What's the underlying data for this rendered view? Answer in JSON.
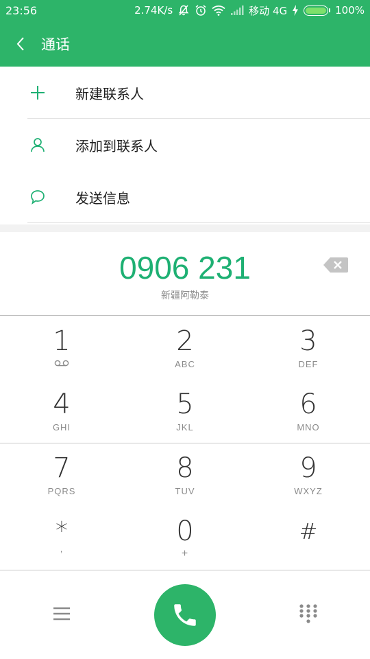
{
  "status_bar": {
    "time": "23:56",
    "speed": "2.74K/s",
    "carrier": "移动 4G",
    "battery": "100%",
    "battery_level": 1.0,
    "icons": [
      "mute-notification-icon",
      "alarm-icon",
      "wifi-icon",
      "signal-icon",
      "charging-icon",
      "battery-icon"
    ]
  },
  "app_bar": {
    "title": "通话",
    "background": "#2db469",
    "back_icon": "chevron-left-icon"
  },
  "menu": {
    "items": [
      {
        "label": "新建联系人",
        "icon": "plus-icon"
      },
      {
        "label": "添加到联系人",
        "icon": "person-icon"
      },
      {
        "label": "发送信息",
        "icon": "message-bubble-icon"
      }
    ]
  },
  "dial_display": {
    "number": "0906 231",
    "location": "新疆阿勒泰",
    "number_color": "#1eb073"
  },
  "keypad": {
    "keys": [
      {
        "digit": "1",
        "letters": ""
      },
      {
        "digit": "2",
        "letters": "ABC"
      },
      {
        "digit": "3",
        "letters": "DEF"
      },
      {
        "digit": "4",
        "letters": "GHI"
      },
      {
        "digit": "5",
        "letters": "JKL"
      },
      {
        "digit": "6",
        "letters": "MNO"
      },
      {
        "digit": "7",
        "letters": "PQRS"
      },
      {
        "digit": "8",
        "letters": "TUV"
      },
      {
        "digit": "9",
        "letters": "WXYZ"
      },
      {
        "digit": "*",
        "letters": ","
      },
      {
        "digit": "0",
        "letters": "+"
      },
      {
        "digit": "#",
        "letters": ""
      }
    ]
  },
  "bottom_bar": {
    "menu_icon": "hamburger-menu-icon",
    "call_icon": "phone-icon",
    "dialpad_icon": "dialpad-icon",
    "accent": "#2db469"
  }
}
